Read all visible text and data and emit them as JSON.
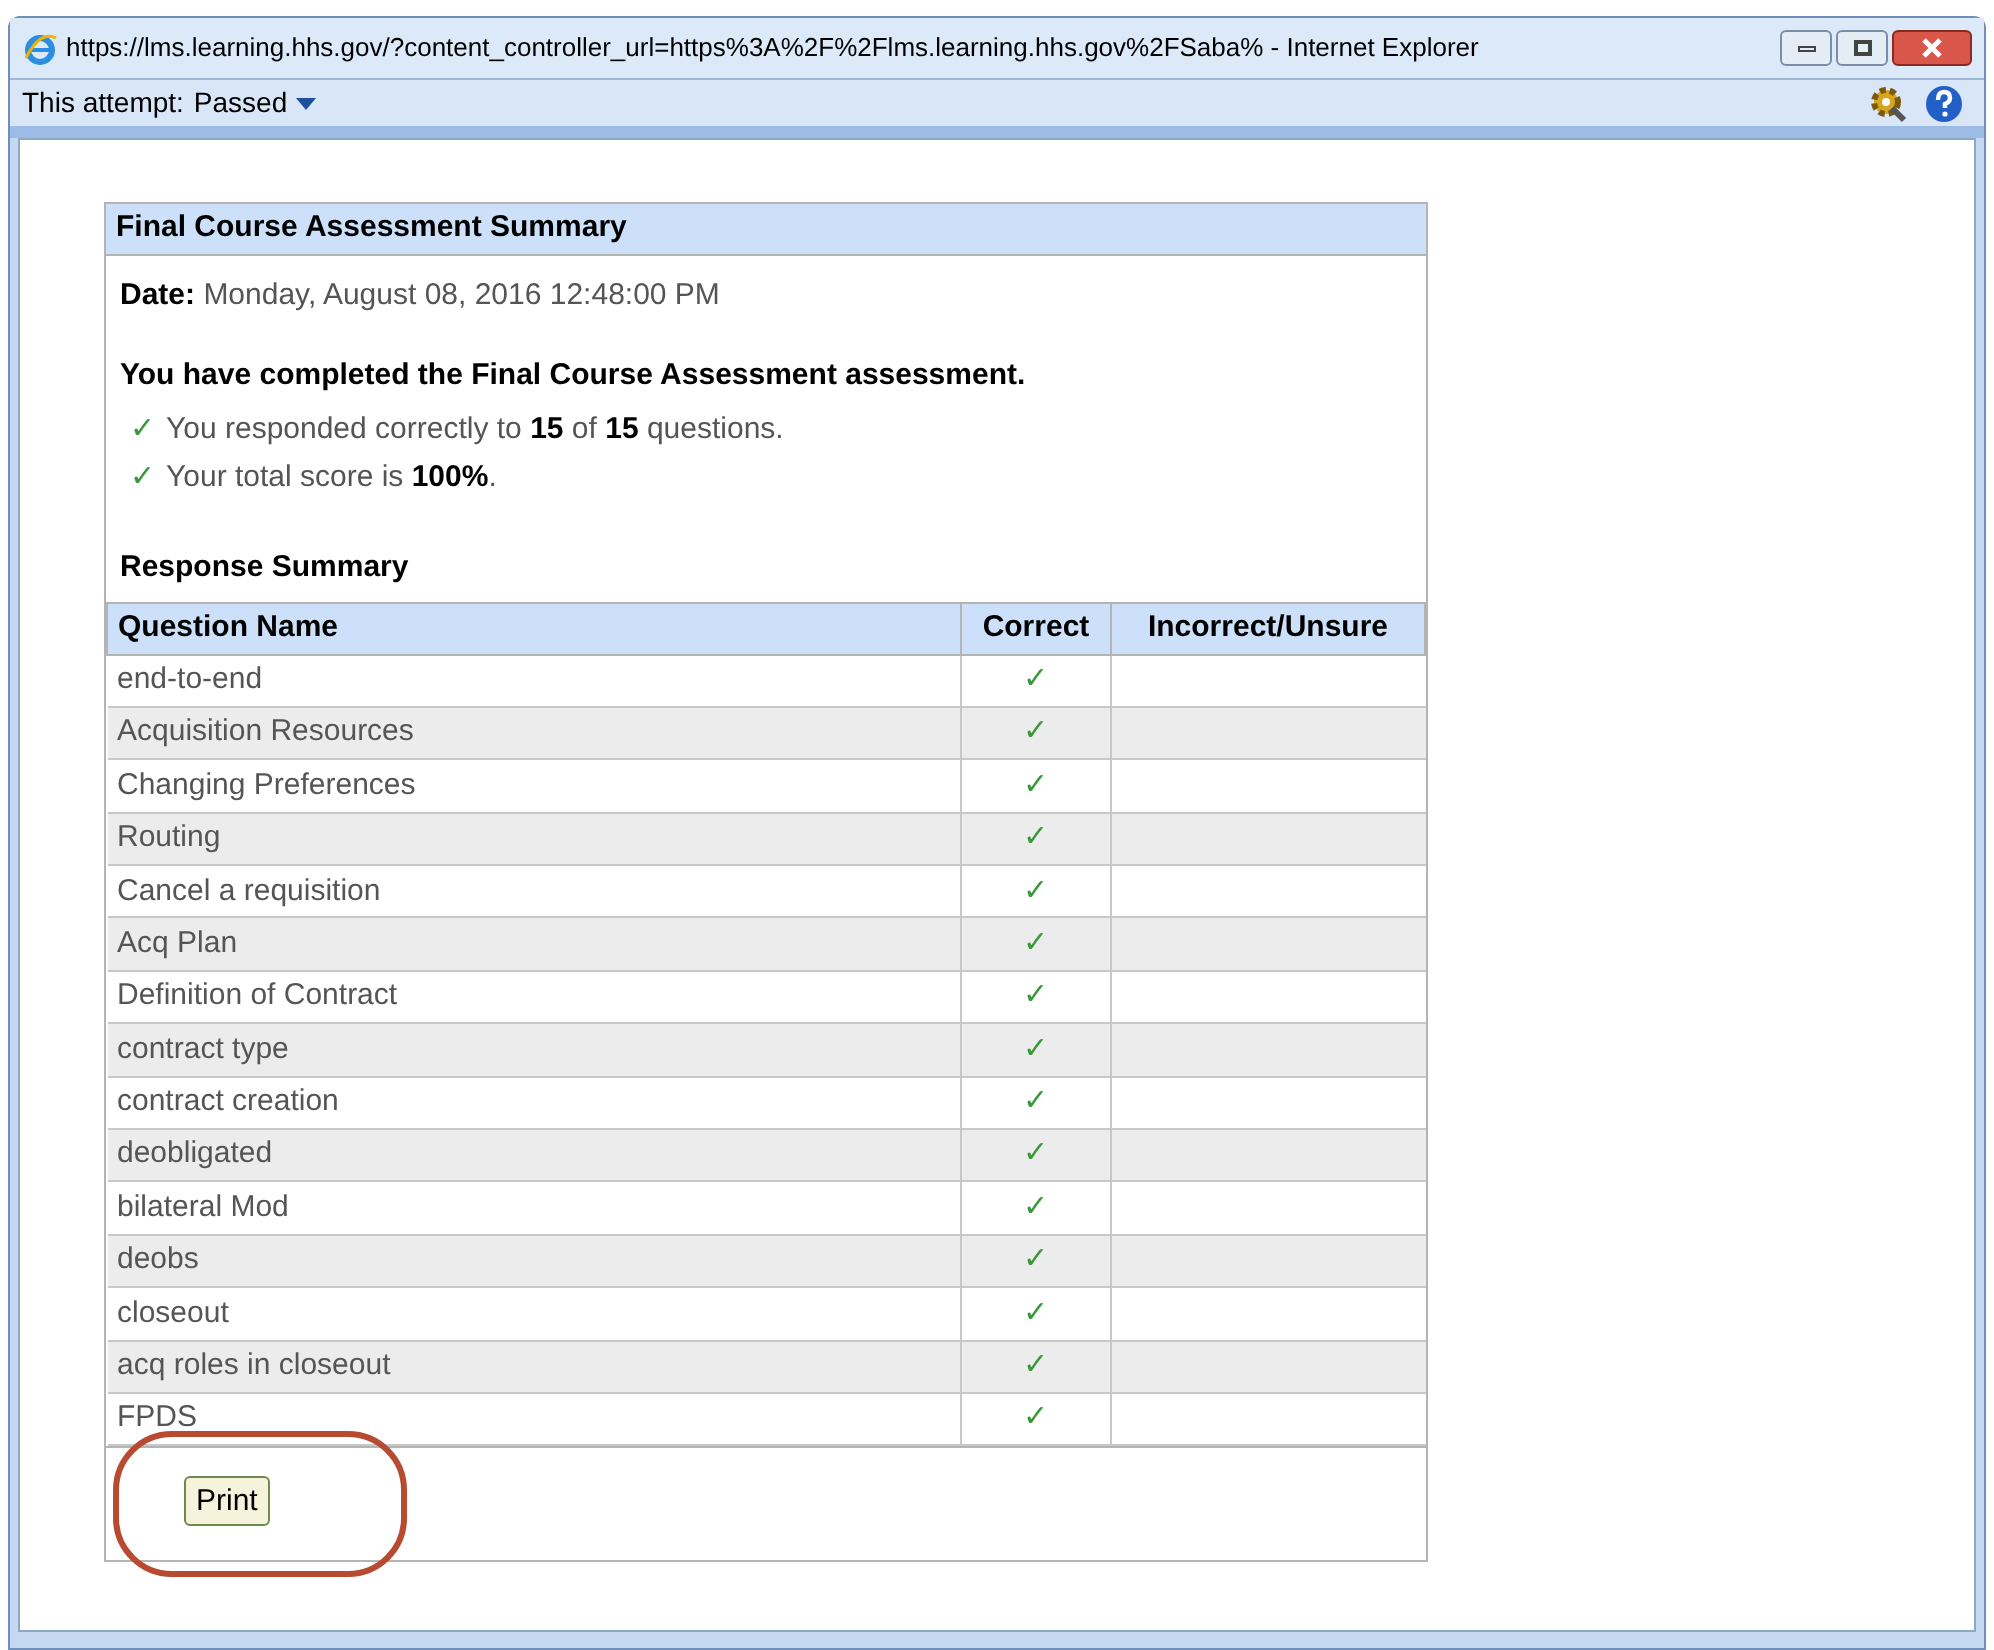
{
  "window": {
    "title": "https://lms.learning.hhs.gov/?content_controller_url=https%3A%2F%2Flms.learning.hhs.gov%2FSaba% - Internet Explorer"
  },
  "toolbar": {
    "label": "This attempt:",
    "value": "Passed"
  },
  "summary": {
    "title": "Final Course Assessment Summary",
    "date_label": "Date:",
    "date": "Monday, August 08, 2016 12:48:00 PM",
    "heading": "You have completed the Final Course Assessment assessment.",
    "results": [
      {
        "check": "✓",
        "text": "You responded correctly to **15** of **15** questions."
      },
      {
        "check": "✓",
        "text": "Your total score is **100%**."
      }
    ],
    "response_heading": "Response Summary",
    "columns": [
      "Question Name",
      "Correct",
      "Incorrect/Unsure"
    ],
    "rows": [
      {
        "name": "end-to-end",
        "correct": true
      },
      {
        "name": "Acquisition Resources",
        "correct": true
      },
      {
        "name": "Changing Preferences",
        "correct": true
      },
      {
        "name": "Routing",
        "correct": true
      },
      {
        "name": "Cancel a requisition",
        "correct": true
      },
      {
        "name": "Acq Plan",
        "correct": true
      },
      {
        "name": "Definition of Contract",
        "correct": true
      },
      {
        "name": "contract type",
        "correct": true
      },
      {
        "name": "contract creation",
        "correct": true
      },
      {
        "name": "deobligated",
        "correct": true
      },
      {
        "name": "bilateral Mod",
        "correct": true
      },
      {
        "name": "deobs",
        "correct": true
      },
      {
        "name": "closeout",
        "correct": true
      },
      {
        "name": "acq roles in closeout",
        "correct": true
      },
      {
        "name": "FPDS",
        "correct": true
      }
    ],
    "check_mark": "✓",
    "print_button": "Print"
  }
}
